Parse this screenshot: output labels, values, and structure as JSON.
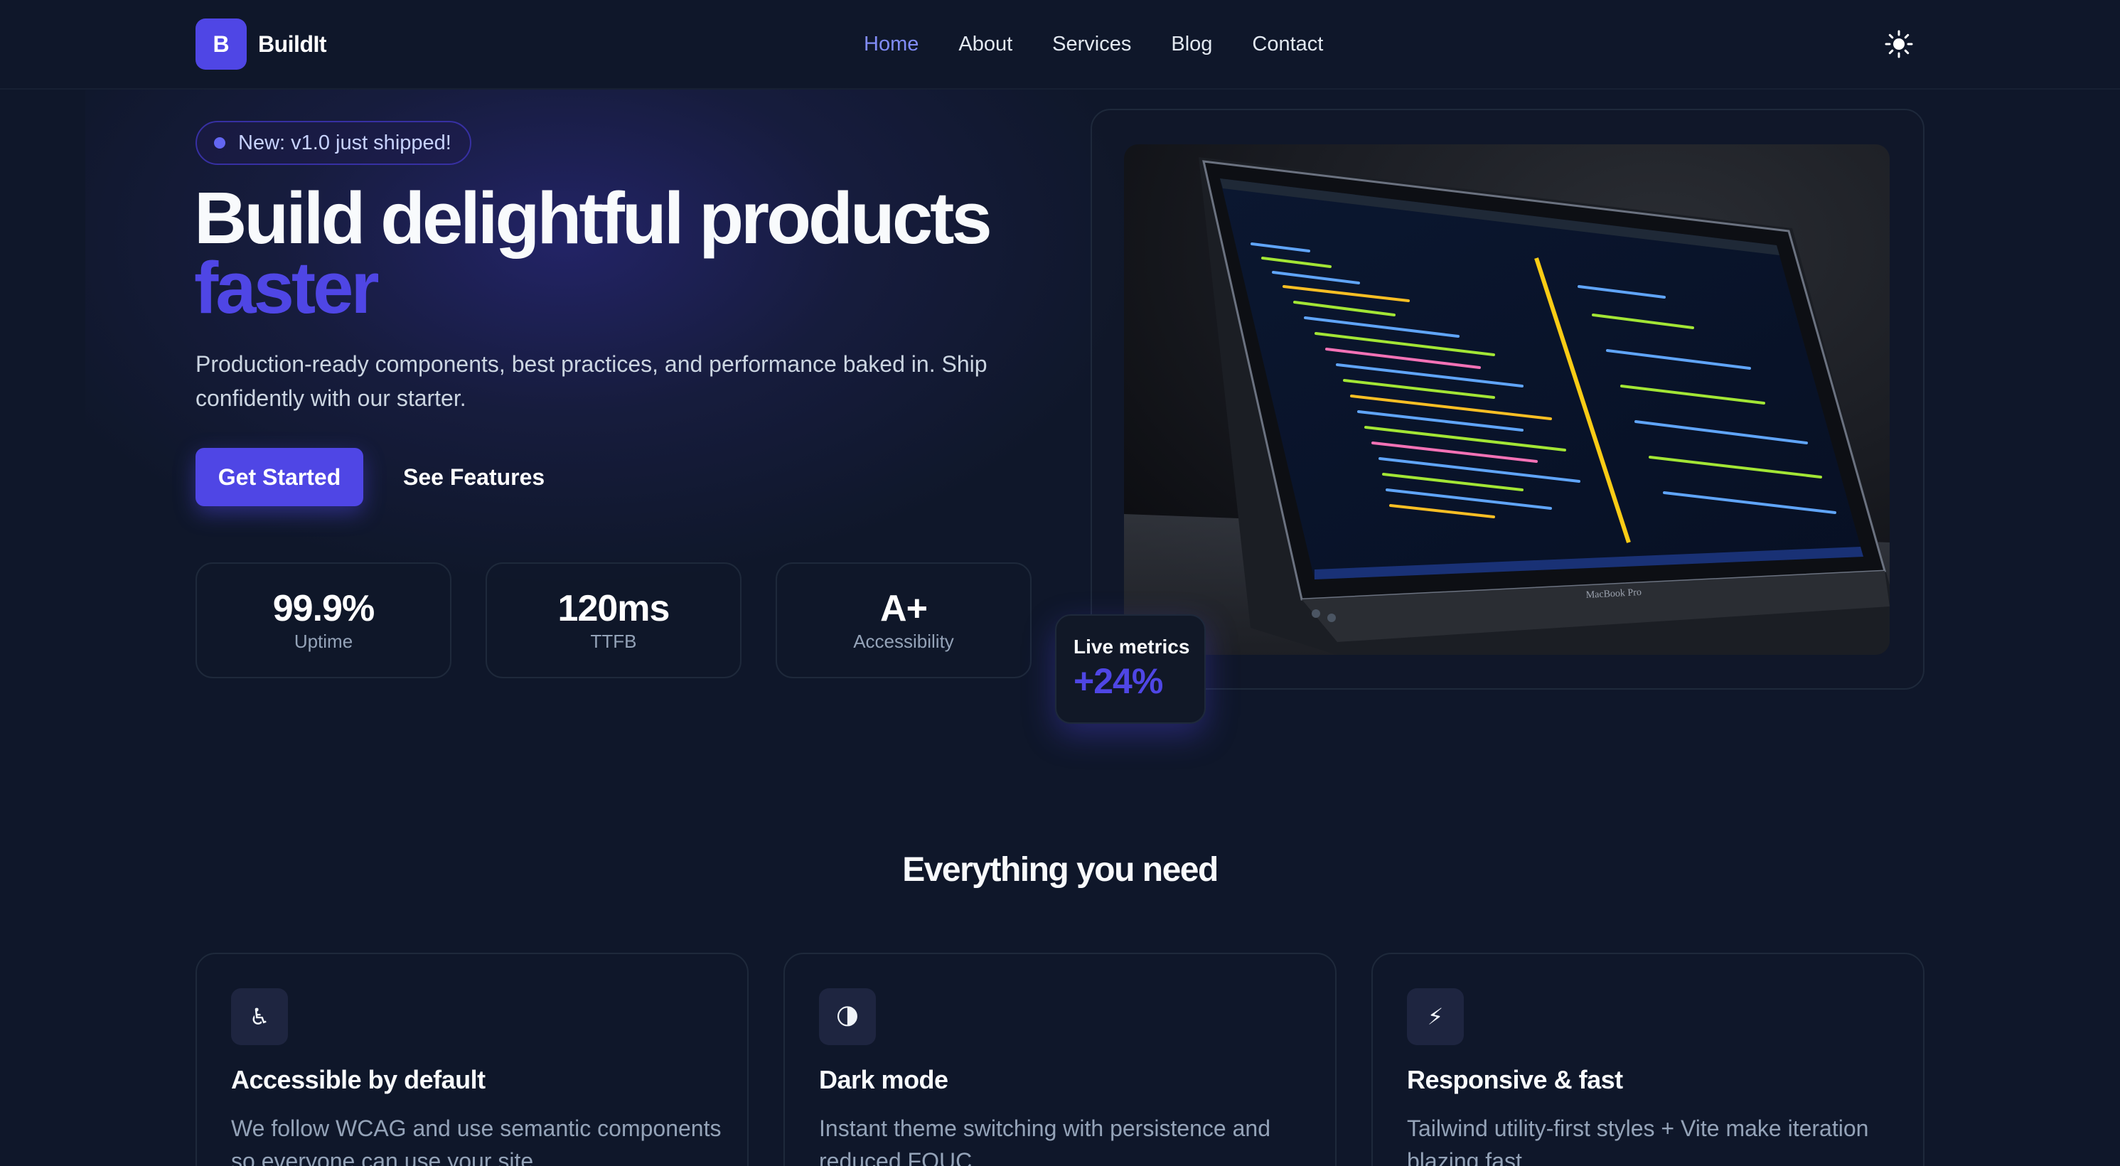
{
  "brand": {
    "logo_letter": "B",
    "name": "BuildIt"
  },
  "nav": {
    "items": [
      {
        "label": "Home",
        "active": true
      },
      {
        "label": "About",
        "active": false
      },
      {
        "label": "Services",
        "active": false
      },
      {
        "label": "Blog",
        "active": false
      },
      {
        "label": "Contact",
        "active": false
      }
    ],
    "theme_toggle_icon": "sun-icon"
  },
  "hero": {
    "badge": "New: v1.0 just shipped!",
    "title_line1": "Build delightful products",
    "title_accent": "faster",
    "subtitle": "Production-ready components, best practices, and performance baked in. Ship confidently with our starter.",
    "primary_cta": "Get Started",
    "secondary_cta": "See Features",
    "stats": [
      {
        "value": "99.9%",
        "label": "Uptime"
      },
      {
        "value": "120ms",
        "label": "TTFB"
      },
      {
        "value": "A+",
        "label": "Accessibility"
      }
    ],
    "image_alt": "Laptop showing code editor",
    "laptop_brand_text": "MacBook Pro",
    "live_card": {
      "label": "Live metrics",
      "value": "+24%"
    }
  },
  "features": {
    "title": "Everything you need",
    "items": [
      {
        "icon": "accessibility-icon",
        "glyph": "♿",
        "title": "Accessible by default",
        "desc": "We follow WCAG and use semantic components so everyone can use your site."
      },
      {
        "icon": "half-moon-icon",
        "glyph": "🌗",
        "title": "Dark mode",
        "desc": "Instant theme switching with persistence and reduced FOUC."
      },
      {
        "icon": "lightning-icon",
        "glyph": "⚡",
        "title": "Responsive & fast",
        "desc": "Tailwind utility-first styles + Vite make iteration blazing fast."
      }
    ]
  },
  "colors": {
    "background": "#0f172a",
    "accent": "#4f46e5",
    "accent_light": "#818cf8",
    "muted_text": "#94a3b8"
  }
}
